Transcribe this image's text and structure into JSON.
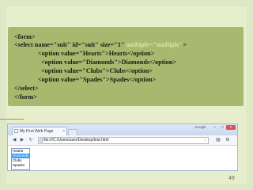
{
  "code": {
    "lines": [
      "<form>",
      "<select name=\"suit\" id=\"suit\" size=\"1\" ",
      "<option value=\"Hearts\">Hearts</option>",
      "<option value=\"Diamonds\">Diamonds</option>",
      "<option value=\"Clubs\">Clubs</option>",
      "<option value=\"Spades\">Spades</option>",
      "</select>",
      "</form>"
    ],
    "highlight": "multiple=\"multiple\"",
    "line2_suffix": ">"
  },
  "browser": {
    "tab_title": "My First Web Page",
    "tab_close": "×",
    "google_label": "Google",
    "minimize": "−",
    "maximize": "□",
    "close": "×",
    "url": "file:///C:/Users/user/Desktop/test.html",
    "back": "◀",
    "forward": "▶",
    "reload": "↻",
    "star": "☆",
    "page_menu": "▤",
    "tools_menu": "⚙"
  },
  "select_options": [
    "Hearts",
    "Diamonds",
    "Clubs",
    "Spades"
  ],
  "selected_index": 1,
  "page_number": "49"
}
